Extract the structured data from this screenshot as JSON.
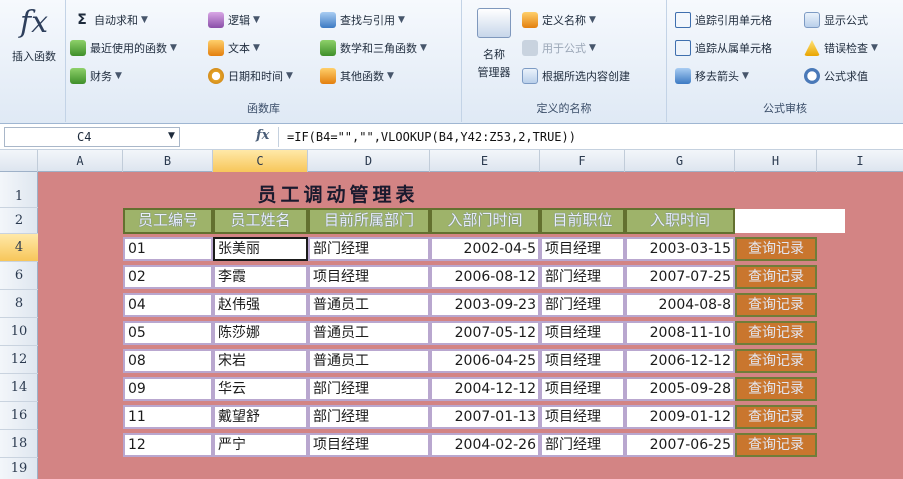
{
  "ribbon": {
    "insert_function": {
      "glyph": "fx",
      "label": "插入函数"
    },
    "function_library": {
      "label": "函数库",
      "autosum": "自动求和",
      "recent": "最近使用的函数",
      "financial": "财务",
      "logical": "逻辑",
      "text": "文本",
      "datetime": "日期和时间",
      "lookup": "查找与引用",
      "math": "数学和三角函数",
      "more": "其他函数"
    },
    "defined_names": {
      "label": "定义的名称",
      "name_manager_line1": "名称",
      "name_manager_line2": "管理器",
      "define_name": "定义名称",
      "use_in_formula": "用于公式",
      "create_from_selection": "根据所选内容创建"
    },
    "formula_auditing": {
      "label": "公式审核",
      "trace_precedents": "追踪引用单元格",
      "trace_dependents": "追踪从属单元格",
      "remove_arrows": "移去箭头",
      "show_formulas": "显示公式",
      "error_checking": "错误检查",
      "evaluate_formula": "公式求值"
    }
  },
  "formula_bar": {
    "name_box": "C4",
    "fx": "fx",
    "formula": "=IF(B4=\"\",\"\",VLOOKUP(B4,Y42:Z53,2,TRUE))"
  },
  "columns": [
    "A",
    "B",
    "C",
    "D",
    "E",
    "F",
    "G",
    "H",
    "I"
  ],
  "rows": [
    "1",
    "2",
    "4",
    "6",
    "8",
    "10",
    "12",
    "14",
    "16",
    "18",
    "19"
  ],
  "sheet": {
    "title": "员工调动管理表",
    "headers": [
      "员工编号",
      "员工姓名",
      "目前所属部门",
      "入部门时间",
      "目前职位",
      "入职时间"
    ],
    "link_label": "查询记录",
    "records": [
      [
        "01",
        "张美丽",
        "部门经理",
        "2002-04-5",
        "项目经理",
        "2003-03-15"
      ],
      [
        "02",
        "李霞",
        "项目经理",
        "2006-08-12",
        "部门经理",
        "2007-07-25"
      ],
      [
        "04",
        "赵伟强",
        "普通员工",
        "2003-09-23",
        "部门经理",
        "2004-08-8"
      ],
      [
        "05",
        "陈莎娜",
        "普通员工",
        "2007-05-12",
        "项目经理",
        "2008-11-10"
      ],
      [
        "08",
        "宋岩",
        "普通员工",
        "2006-04-25",
        "项目经理",
        "2006-12-12"
      ],
      [
        "09",
        "华云",
        "部门经理",
        "2004-12-12",
        "项目经理",
        "2005-09-28"
      ],
      [
        "11",
        "戴望舒",
        "部门经理",
        "2007-01-13",
        "项目经理",
        "2009-01-12"
      ],
      [
        "12",
        "严宁",
        "项目经理",
        "2004-02-26",
        "部门经理",
        "2007-06-25"
      ]
    ]
  }
}
